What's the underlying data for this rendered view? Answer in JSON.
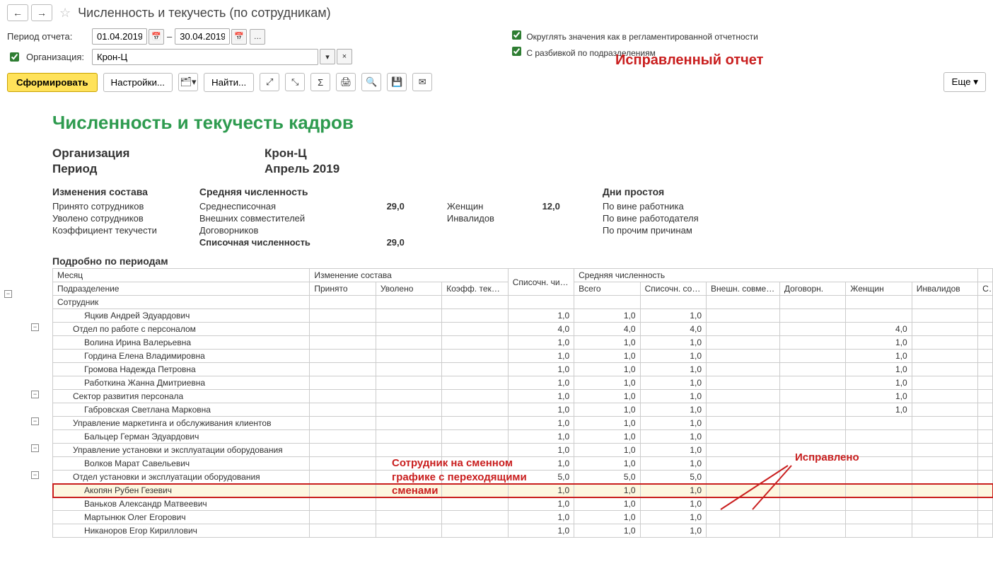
{
  "page": {
    "title": "Численность и текучесть (по сотрудникам)"
  },
  "period": {
    "label": "Период отчета:",
    "from": "01.04.2019",
    "to": "30.04.2019",
    "dash": "–"
  },
  "org": {
    "chk_label": "Организация:",
    "value": "Крон-Ц"
  },
  "options": {
    "round_label": "Округлять значения как в регламентированной отчетности",
    "by_dept_label": "С разбивкой по подразделениям"
  },
  "red_title": "Исправленный отчет",
  "buttons": {
    "form": "Сформировать",
    "settings": "Настройки...",
    "find": "Найти...",
    "more": "Еще"
  },
  "report": {
    "title": "Численность и текучесть кадров",
    "org_lbl": "Организация",
    "org_val": "Крон-Ц",
    "period_lbl": "Период",
    "period_val": "Апрель 2019",
    "s1_h": "Изменения состава",
    "s1": [
      "Принято сотрудников",
      "Уволено сотрудников",
      "Коэффициент текучести"
    ],
    "s2_h": "Средняя численность",
    "s2": [
      {
        "l": "Среднесписочная",
        "v": "29,0"
      },
      {
        "l": "Внешних совместителей",
        "v": ""
      },
      {
        "l": "Договорников",
        "v": ""
      }
    ],
    "s2b": {
      "l": "Списочная численность",
      "v": "29,0"
    },
    "s3": [
      {
        "l": "Женщин",
        "v": "12,0"
      },
      {
        "l": "Инвалидов",
        "v": ""
      }
    ],
    "s4_h": "Дни простоя",
    "s4": [
      "По вине работника",
      "По вине работодателя",
      "По прочим причинам"
    ],
    "detail_h": "Подробно по периодам"
  },
  "thead": {
    "r1": [
      "Месяц",
      "Изменение состава",
      "",
      "",
      "Списочн. численн.",
      "Средняя численность",
      "",
      "",
      "",
      "",
      "",
      ""
    ],
    "r2": [
      "Подразделение",
      "Принято",
      "Уволено",
      "Коэфф. текучести",
      "",
      "Всего",
      "Списочн. состава",
      "Внешн. совместит.",
      "Договорн.",
      "Женщин",
      "Инвалидов",
      "С"
    ],
    "r3": [
      "Сотрудник",
      "",
      "",
      "",
      "",
      "",
      "",
      "",
      "",
      "",
      "",
      ""
    ]
  },
  "rows": [
    {
      "i": 2,
      "n": "Яцкив Андрей Эдуардович",
      "sp": "1,0",
      "vs": "1,0",
      "sc": "1,0"
    },
    {
      "i": 1,
      "n": "Отдел по работе с персоналом",
      "sp": "4,0",
      "vs": "4,0",
      "sc": "4,0",
      "zh": "4,0",
      "tree": "minus"
    },
    {
      "i": 2,
      "n": "Волина Ирина Валерьевна",
      "sp": "1,0",
      "vs": "1,0",
      "sc": "1,0",
      "zh": "1,0"
    },
    {
      "i": 2,
      "n": "Гордина Елена Владимировна",
      "sp": "1,0",
      "vs": "1,0",
      "sc": "1,0",
      "zh": "1,0"
    },
    {
      "i": 2,
      "n": "Громова Надежда Петровна",
      "sp": "1,0",
      "vs": "1,0",
      "sc": "1,0",
      "zh": "1,0"
    },
    {
      "i": 2,
      "n": "Работкина Жанна Дмитриевна",
      "sp": "1,0",
      "vs": "1,0",
      "sc": "1,0",
      "zh": "1,0"
    },
    {
      "i": 1,
      "n": "Сектор развития персонала",
      "sp": "1,0",
      "vs": "1,0",
      "sc": "1,0",
      "zh": "1,0",
      "tree": "minus"
    },
    {
      "i": 2,
      "n": "Габровская Светлана Марковна",
      "sp": "1,0",
      "vs": "1,0",
      "sc": "1,0",
      "zh": "1,0"
    },
    {
      "i": 1,
      "n": "Управление маркетинга и обслуживания клиентов",
      "sp": "1,0",
      "vs": "1,0",
      "sc": "1,0",
      "tree": "minus"
    },
    {
      "i": 2,
      "n": "Бальцер Герман Эдуардович",
      "sp": "1,0",
      "vs": "1,0",
      "sc": "1,0"
    },
    {
      "i": 1,
      "n": "Управление установки и эксплуатации оборудования",
      "sp": "1,0",
      "vs": "1,0",
      "sc": "1,0",
      "tree": "minus"
    },
    {
      "i": 2,
      "n": "Волков Марат Савельевич",
      "sp": "1,0",
      "vs": "1,0",
      "sc": "1,0"
    },
    {
      "i": 1,
      "n": "Отдел установки и эксплуатации оборудования",
      "sp": "5,0",
      "vs": "5,0",
      "sc": "5,0",
      "tree": "minus"
    },
    {
      "i": 2,
      "n": "Акопян Рубен Гезевич",
      "sp": "1,0",
      "vs": "1,0",
      "sc": "1,0",
      "hl": true
    },
    {
      "i": 2,
      "n": "Ваньков Александр Матвеевич",
      "sp": "1,0",
      "vs": "1,0",
      "sc": "1,0"
    },
    {
      "i": 2,
      "n": "Мартынюк Олег Егорович",
      "sp": "1,0",
      "vs": "1,0",
      "sc": "1,0"
    },
    {
      "i": 2,
      "n": "Никаноров Егор Кириллович",
      "sp": "1,0",
      "vs": "1,0",
      "sc": "1,0"
    }
  ],
  "annotations": {
    "a1_l1": "Сотрудник на сменном",
    "a1_l2": "графике с переходящими",
    "a1_l3": "сменами",
    "a2": "Исправлено"
  }
}
